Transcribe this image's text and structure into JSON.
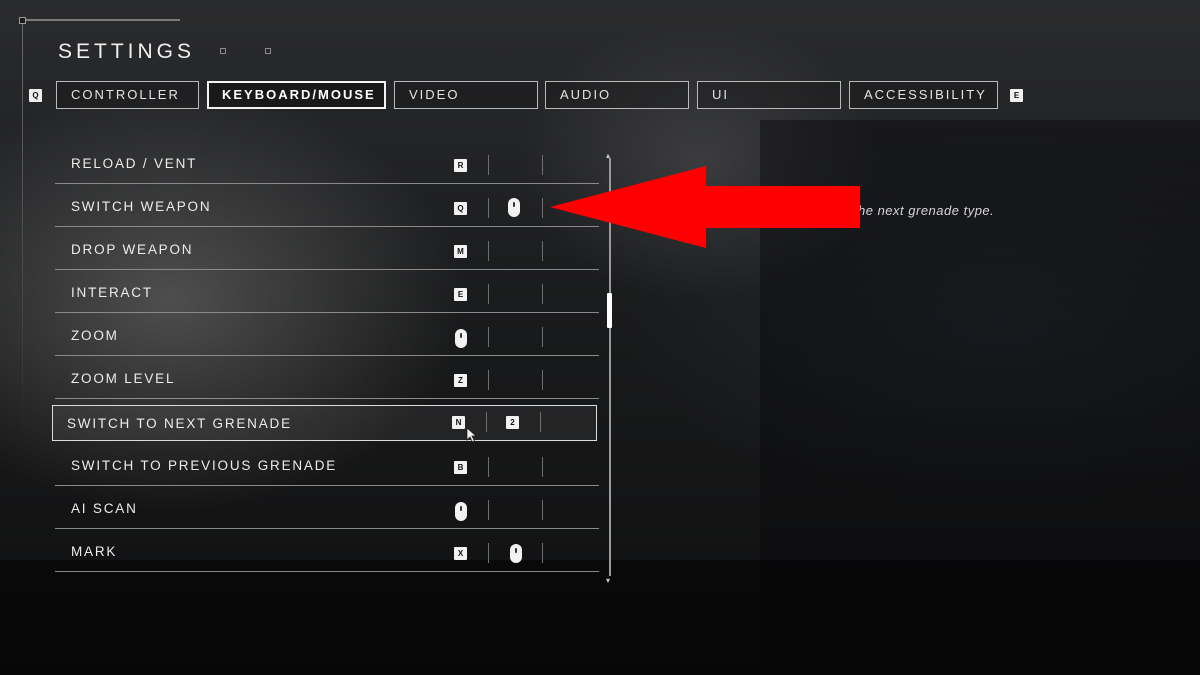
{
  "header": {
    "title": "SETTINGS"
  },
  "tabs": {
    "prev_key": "Q",
    "next_key": "E",
    "items": [
      {
        "label": "CONTROLLER",
        "active": false
      },
      {
        "label": "KEYBOARD/MOUSE",
        "active": true
      },
      {
        "label": "VIDEO",
        "active": false
      },
      {
        "label": "AUDIO",
        "active": false
      },
      {
        "label": "UI",
        "active": false
      },
      {
        "label": "ACCESSIBILITY",
        "active": false
      }
    ]
  },
  "bindings": [
    {
      "action": "RELOAD / VENT",
      "primary": "R",
      "secondary": ""
    },
    {
      "action": "SWITCH WEAPON",
      "primary": "Q",
      "secondary": "mouse-scroll-icon"
    },
    {
      "action": "DROP WEAPON",
      "primary": "M",
      "secondary": ""
    },
    {
      "action": "INTERACT",
      "primary": "E",
      "secondary": ""
    },
    {
      "action": "ZOOM",
      "primary": "mouse-right-click-icon",
      "secondary": ""
    },
    {
      "action": "ZOOM LEVEL",
      "primary": "Z",
      "secondary": ""
    },
    {
      "action": "SWITCH TO NEXT GRENADE",
      "primary": "N",
      "secondary": "2",
      "selected": true
    },
    {
      "action": "SWITCH TO PREVIOUS GRENADE",
      "primary": "B",
      "secondary": ""
    },
    {
      "action": "AI SCAN",
      "primary": "mouse-side-button-icon",
      "secondary": ""
    },
    {
      "action": "MARK",
      "primary": "X",
      "secondary": "mouse-middle-click-icon"
    }
  ],
  "description": "he next grenade type.",
  "annotation": {
    "arrow_color": "#ff0000"
  }
}
